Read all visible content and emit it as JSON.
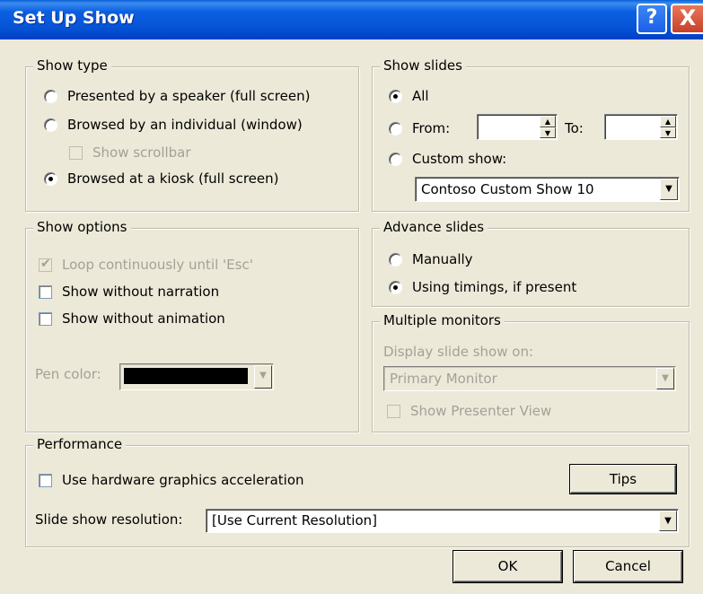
{
  "window": {
    "title": "Set Up Show"
  },
  "title_buttons": {
    "help": "?",
    "close": "X"
  },
  "show_type": {
    "legend": "Show type",
    "opt_speaker": "Presented by a speaker (full screen)",
    "opt_individual": "Browsed by an individual (window)",
    "show_scrollbar": "Show scrollbar",
    "opt_kiosk": "Browsed at a kiosk (full screen)",
    "selected": "kiosk"
  },
  "show_slides": {
    "legend": "Show slides",
    "opt_all": "All",
    "opt_from": "From:",
    "to_label": "To:",
    "from_value": "",
    "to_value": "",
    "opt_custom": "Custom show:",
    "custom_value": "Contoso Custom Show 10",
    "selected": "all"
  },
  "show_options": {
    "legend": "Show options",
    "loop": "Loop continuously until 'Esc'",
    "loop_checked": true,
    "without_narration": "Show without narration",
    "without_animation": "Show without animation",
    "pen_color_label": "Pen color:",
    "pen_color": "#000000"
  },
  "advance_slides": {
    "legend": "Advance slides",
    "opt_manually": "Manually",
    "opt_timings": "Using timings, if present",
    "selected": "timings"
  },
  "multiple_monitors": {
    "legend": "Multiple monitors",
    "display_label": "Display slide show on:",
    "display_value": "Primary Monitor",
    "presenter_view": "Show Presenter View"
  },
  "performance": {
    "legend": "Performance",
    "hw_accel": "Use hardware graphics acceleration",
    "tips": "Tips",
    "resolution_label": "Slide show resolution:",
    "resolution_value": "[Use Current Resolution]"
  },
  "buttons": {
    "ok": "OK",
    "cancel": "Cancel"
  },
  "colors": {
    "titlebar": "#0654d6",
    "dialog_bg": "#ece9d8",
    "disabled_text": "#a3a198"
  }
}
